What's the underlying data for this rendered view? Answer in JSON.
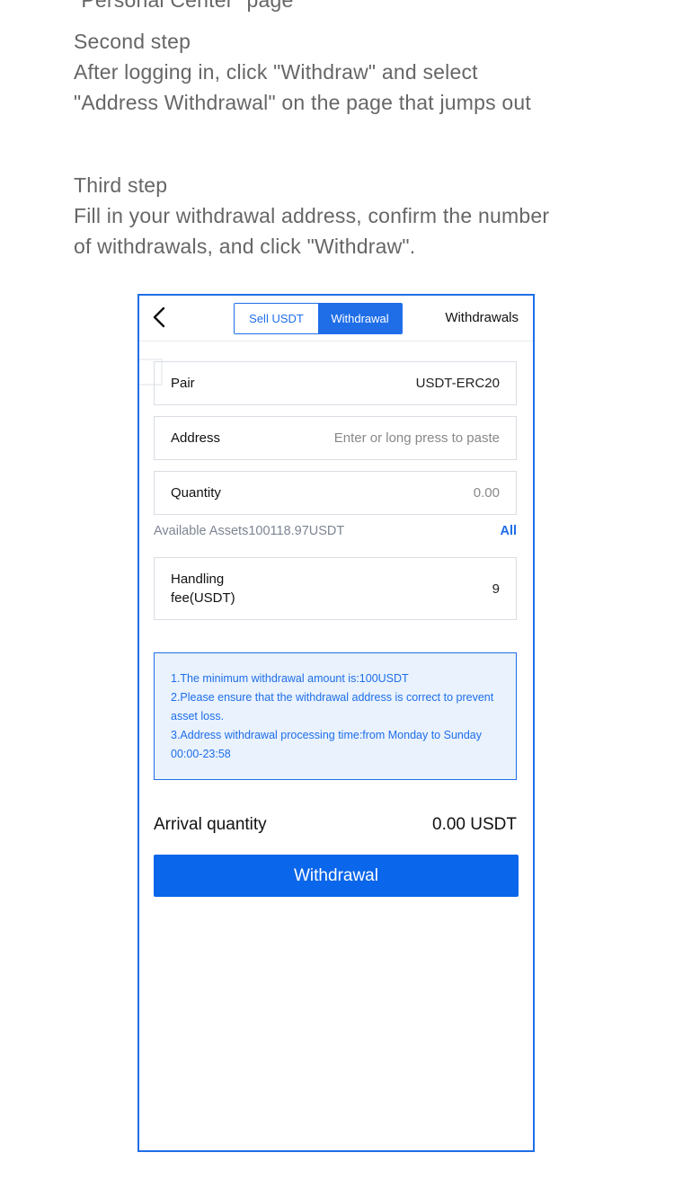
{
  "instructions": {
    "top_cutoff": "\"Personal Center\" page",
    "step2_title": "Second step",
    "step2_line1": "After logging in, click \"Withdraw\" and select",
    "step2_line2": "\"Address Withdrawal\" on the page that jumps out",
    "step3_title": "Third step",
    "step3_line1": "Fill in your withdrawal address, confirm the number",
    "step3_line2": "of withdrawals, and click \"Withdraw\"."
  },
  "nav": {
    "back_icon": "chevron-left-icon",
    "tab_sell": "Sell USDT",
    "tab_withdrawal": "Withdrawal",
    "right_link": "Withdrawals"
  },
  "form": {
    "pair_label": "Pair",
    "pair_value": "USDT-ERC20",
    "address_label": "Address",
    "address_placeholder": "Enter or long press to paste",
    "quantity_label": "Quantity",
    "quantity_placeholder": "0.00",
    "available": "Available Assets100118.97USDT",
    "all_label": "All",
    "fee_label": "Handling fee(USDT)",
    "fee_value": "9"
  },
  "notice": {
    "line1": "1.The minimum withdrawal amount is:100USDT",
    "line2": "2.Please ensure that the withdrawal address is correct to prevent asset loss.",
    "line3": "3.Address withdrawal processing time:from Monday to Sunday 00:00-23:58"
  },
  "arrival": {
    "label": "Arrival quantity",
    "value": "0.00 USDT"
  },
  "submit_label": "Withdrawal",
  "colors": {
    "accent": "#1f6ee8",
    "button": "#0a66ea",
    "notice_bg": "#e9f2fd",
    "instruction_text": "#666666"
  }
}
